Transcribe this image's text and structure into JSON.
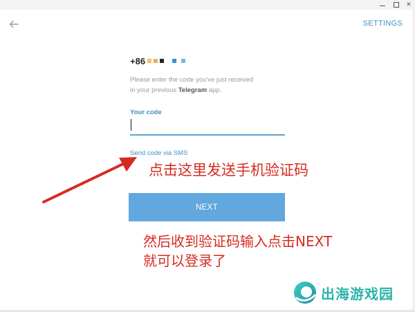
{
  "window": {
    "controls": [
      "minimize",
      "maximize",
      "close"
    ],
    "close_glyph": "✕"
  },
  "header": {
    "back_icon": "arrow-left-icon",
    "settings_label": "SETTINGS"
  },
  "login": {
    "phone_prefix": "+86",
    "mask_colors": [
      "#f2c265",
      "#e6b15a",
      "#222222",
      "#3a8fd0",
      "#7ab8e6"
    ],
    "hint_line1": "Please enter the code you've just received",
    "hint_line2_before": "in your previous ",
    "hint_line2_bold": "Telegram",
    "hint_line2_after": " app.",
    "code_label": "Your code",
    "code_value": "",
    "sms_link": "Send code via SMS",
    "next_label": "NEXT"
  },
  "annotations": {
    "note1": "点击这里发送手机验证码",
    "note2_line1": "然后收到验证码输入点击NEXT",
    "note2_line2": "就可以登录了",
    "color": "#d62a21"
  },
  "watermark": {
    "text": "出海游戏园",
    "color": "#2bb3a8"
  },
  "colors": {
    "accent": "#3d8fc7",
    "button": "#62a7dd"
  }
}
